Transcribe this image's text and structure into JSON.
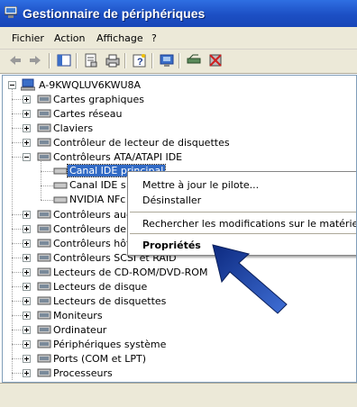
{
  "window": {
    "title": "Gestionnaire de périphériques"
  },
  "menu": [
    "Fichier",
    "Action",
    "Affichage",
    "?"
  ],
  "toolbar_icons": [
    "back-arrow-icon",
    "forward-arrow-icon",
    "show-hide-console-tree-icon",
    "properties-icon",
    "print-icon",
    "help-icon",
    "scan-hardware-icon",
    "update-driver-icon",
    "disable-device-icon",
    "uninstall-device-icon"
  ],
  "tree": {
    "root": "A-9KWQLUV6KWU8A",
    "items": [
      {
        "label": "Cartes graphiques",
        "icon": "display-adapter-icon",
        "expanded": false
      },
      {
        "label": "Cartes réseau",
        "icon": "network-adapter-icon",
        "expanded": false
      },
      {
        "label": "Claviers",
        "icon": "keyboard-icon",
        "expanded": false
      },
      {
        "label": "Contrôleur de lecteur de disquettes",
        "icon": "floppy-controller-icon",
        "expanded": false
      },
      {
        "label": "Contrôleurs ATA/ATAPI IDE",
        "icon": "ide-controller-icon",
        "expanded": true
      },
      {
        "label": "Contrôleurs aud",
        "icon": "audio-controller-icon",
        "expanded": false
      },
      {
        "label": "Contrôleurs de",
        "icon": "storage-controller-icon",
        "expanded": false
      },
      {
        "label": "Contrôleurs hôt",
        "icon": "host-controller-icon",
        "expanded": false
      },
      {
        "label": "Contrôleurs SCSI et RAID",
        "icon": "scsi-controller-icon",
        "expanded": false
      },
      {
        "label": "Lecteurs de CD-ROM/DVD-ROM",
        "icon": "cdrom-icon",
        "expanded": false
      },
      {
        "label": "Lecteurs de disque",
        "icon": "disk-drive-icon",
        "expanded": false
      },
      {
        "label": "Lecteurs de disquettes",
        "icon": "floppy-drive-icon",
        "expanded": false
      },
      {
        "label": "Moniteurs",
        "icon": "monitor-icon",
        "expanded": false
      },
      {
        "label": "Ordinateur",
        "icon": "computer-icon",
        "expanded": false
      },
      {
        "label": "Périphériques système",
        "icon": "system-devices-icon",
        "expanded": false
      },
      {
        "label": "Ports (COM et LPT)",
        "icon": "ports-icon",
        "expanded": false
      },
      {
        "label": "Processeurs",
        "icon": "processor-icon",
        "expanded": false
      }
    ],
    "ide_children": [
      {
        "label": "Canal IDE principal",
        "selected": true
      },
      {
        "label": "Canal IDE s"
      },
      {
        "label": "NVIDIA NFc"
      }
    ]
  },
  "context_menu": {
    "update_driver": "Mettre à jour le pilote...",
    "uninstall": "Désinstaller",
    "scan": "Rechercher les modifications sur le matériel",
    "properties": "Propriétés"
  },
  "colors": {
    "titlebar": "#1c4fc4",
    "selection": "#316ac5",
    "arrow": "#1a3c8c"
  }
}
